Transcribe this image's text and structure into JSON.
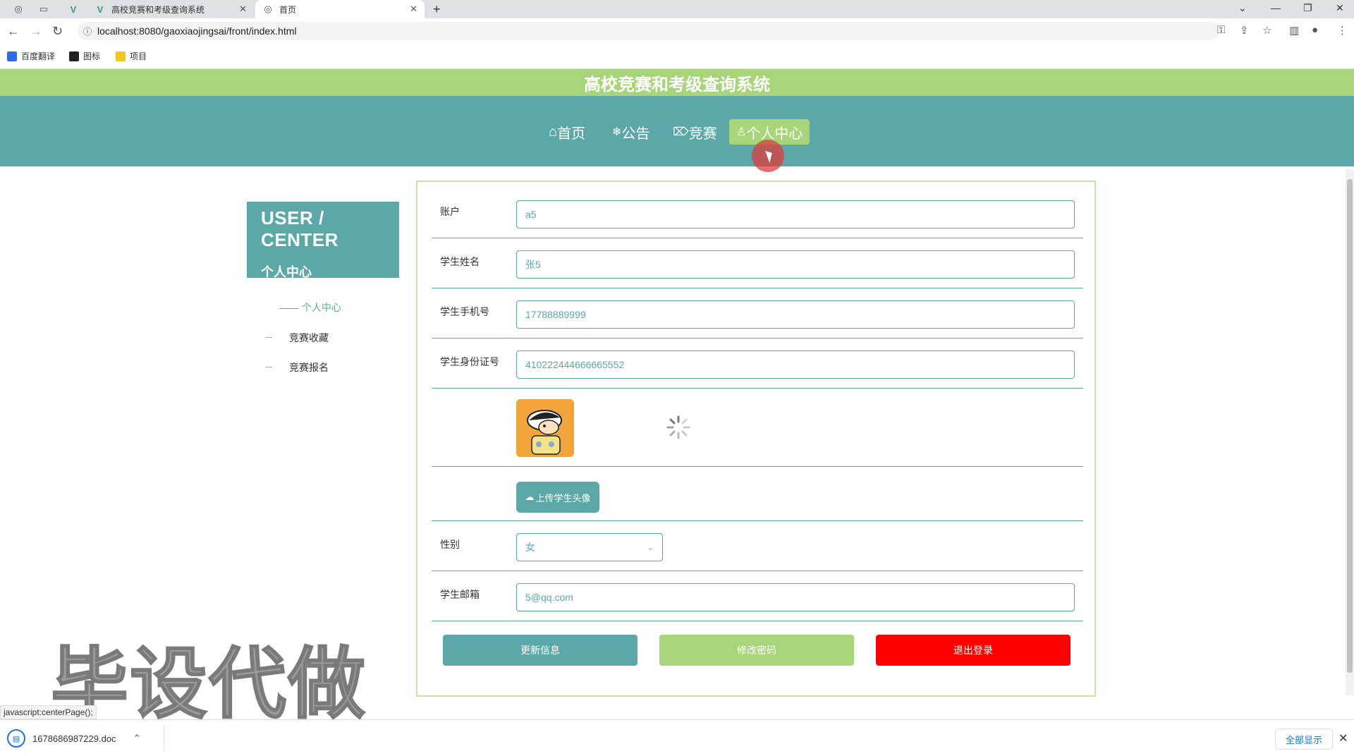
{
  "browser": {
    "tabs": [
      {
        "title": "",
        "icon": "globe-icon"
      },
      {
        "title": "",
        "icon": "blank-tab-icon"
      },
      {
        "title": "",
        "icon": "vue-icon"
      },
      {
        "title": "高校竞赛和考级查询系统",
        "icon": "vue-icon"
      },
      {
        "title": "首页",
        "icon": "globe-icon"
      }
    ],
    "new_tab": "+",
    "url": "localhost:8080/gaoxiaojingsai/front/index.html",
    "bookmarks": [
      "百度翻译",
      "图标",
      "项目"
    ]
  },
  "site": {
    "title": "高校竞赛和考级查询系统",
    "nav": [
      {
        "label": "首页",
        "icon": "home-icon",
        "glyph": "⌂"
      },
      {
        "label": "公告",
        "icon": "snowflake-icon",
        "glyph": "❄"
      },
      {
        "label": "竞赛",
        "icon": "tag-icon",
        "glyph": "⏷"
      },
      {
        "label": "个人中心",
        "icon": "user-icon",
        "glyph": "♙",
        "active": true
      }
    ]
  },
  "sidebar": {
    "title_en": "USER / CENTER",
    "title_cn": "个人中心",
    "items": [
      {
        "label": "—— 个人中心",
        "active": true
      },
      {
        "label": "竞赛收藏",
        "active": false
      },
      {
        "label": "竞赛报名",
        "active": false
      }
    ]
  },
  "form": {
    "account": {
      "label": "账户",
      "value": "a5"
    },
    "name": {
      "label": "学生姓名",
      "value": "张5"
    },
    "phone": {
      "label": "学生手机号",
      "value": "17788889999"
    },
    "idcard": {
      "label": "学生身份证号",
      "value": "410222444666665552"
    },
    "upload_label": "上传学生头像",
    "gender": {
      "label": "性别",
      "value": "女"
    },
    "email": {
      "label": "学生邮箱",
      "value": "5@qq.com"
    },
    "buttons": {
      "update": "更新信息",
      "password": "修改密码",
      "logout": "退出登录"
    }
  },
  "watermark": "毕设代做",
  "status": "javascript:centerPage();",
  "download": {
    "file": "1678686987229.doc",
    "show_all": "全部显示"
  },
  "colors": {
    "teal": "#5ca8a8",
    "green": "#a8d57a",
    "red": "#ff0000"
  }
}
